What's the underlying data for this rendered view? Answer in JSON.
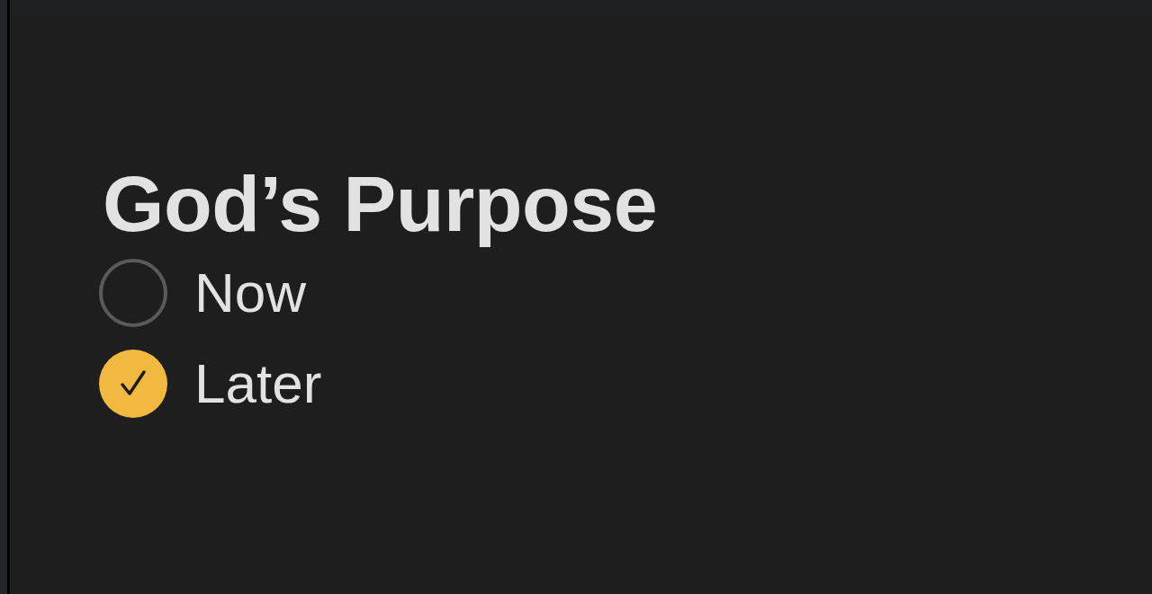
{
  "title": "God’s Purpose",
  "checklist": [
    {
      "label": "Now",
      "checked": false
    },
    {
      "label": "Later",
      "checked": true
    }
  ]
}
